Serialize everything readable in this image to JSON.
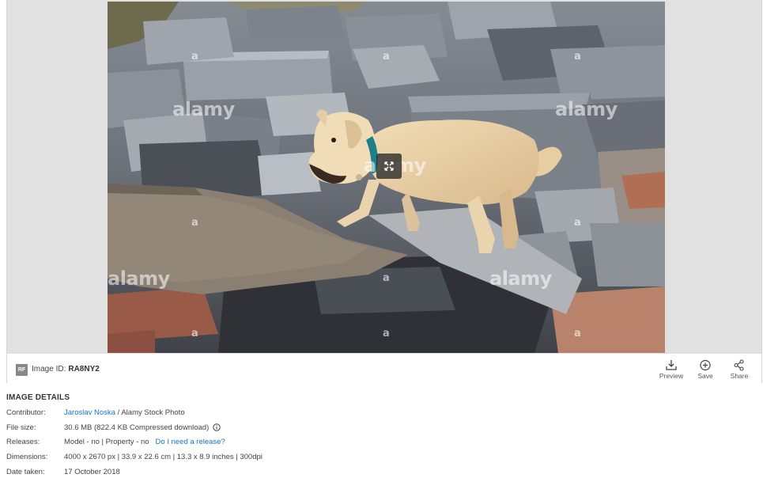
{
  "watermark": {
    "brand": "alamy",
    "mark": "a"
  },
  "toolbar": {
    "rf_badge": "RF",
    "image_id_label": "Image ID:",
    "image_id_value": "RA8NY2",
    "preview_label": "Preview",
    "save_label": "Save",
    "share_label": "Share"
  },
  "details": {
    "title": "IMAGE DETAILS",
    "contributor_label": "Contributor:",
    "contributor_name": "Jaroslav Noska",
    "contributor_suffix": " / Alamy Stock Photo",
    "filesize_label": "File size:",
    "filesize_value": "30.6 MB (822.4 KB Compressed download)",
    "releases_label": "Releases:",
    "releases_value": "Model - no | Property - no",
    "release_link": "Do I need a release?",
    "dimensions_label": "Dimensions:",
    "dimensions_value": "4000 x 2670 px | 33.9 x 22.6 cm | 13.3 x 8.9 inches | 300dpi",
    "date_label": "Date taken:",
    "date_value": "17 October 2018"
  },
  "colors": {
    "link": "#1a73c9",
    "badge": "#888888",
    "stage": "#e1e1e1"
  },
  "icons": [
    "expand-icon",
    "preview-download-icon",
    "plus-circle-icon",
    "share-icon",
    "info-icon"
  ]
}
